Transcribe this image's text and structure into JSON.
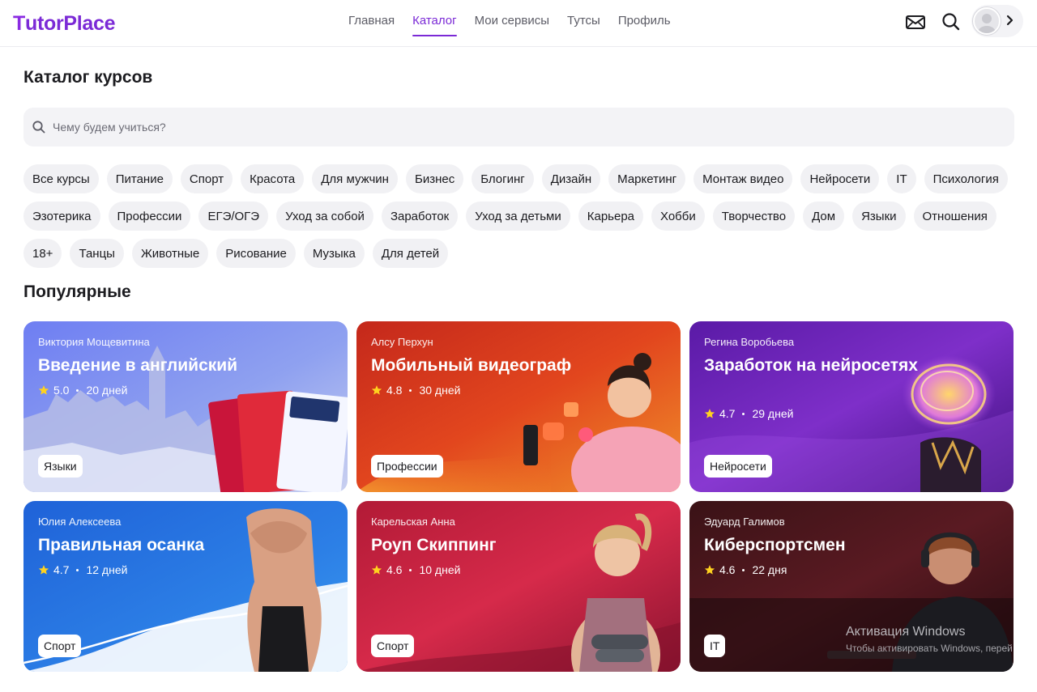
{
  "header": {
    "logo_t": "T",
    "logo_rest": "utorPlace",
    "nav": [
      "Главная",
      "Каталог",
      "Мои сервисы",
      "Тутсы",
      "Профиль"
    ],
    "active_nav": "Каталог"
  },
  "page": {
    "title": "Каталог курсов",
    "search_placeholder": "Чему будем учиться?",
    "popular_title": "Популярные"
  },
  "chips": [
    [
      "Все курсы",
      "Питание",
      "Спорт",
      "Красота",
      "Для мужчин",
      "Бизнес",
      "Блогинг",
      "Дизайн",
      "Маркетинг",
      "Монтаж видео",
      "Нейросети",
      "IT",
      "Психология"
    ],
    [
      "Эзотерика",
      "Профессии",
      "ЕГЭ/ОГЭ",
      "Уход за собой",
      "Заработок",
      "Уход за детьми",
      "Карьера",
      "Хобби",
      "Творчество",
      "Дом",
      "Языки",
      "Отношения"
    ],
    [
      "18+",
      "Танцы",
      "Животные",
      "Рисование",
      "Музыка",
      "Для детей"
    ]
  ],
  "cards": [
    {
      "author": "Виктория Мощевитина",
      "title": "Введение в английский",
      "rating": "5.0",
      "duration": "20 дней",
      "tag": "Языки"
    },
    {
      "author": "Алсу Перхун",
      "title": "Мобильный видеограф",
      "rating": "4.8",
      "duration": "30 дней",
      "tag": "Профессии"
    },
    {
      "author": "Регина Воробьева",
      "title": "Заработок на нейросетях",
      "rating": "4.7",
      "duration": "29 дней",
      "tag": "Нейросети"
    },
    {
      "author": "Юлия Алексеева",
      "title": "Правильная осанка",
      "rating": "4.7",
      "duration": "12 дней",
      "tag": "Спорт"
    },
    {
      "author": "Карельская Анна",
      "title": "Роуп Скиппинг",
      "rating": "4.6",
      "duration": "10 дней",
      "tag": "Спорт"
    },
    {
      "author": "Эдуард Галимов",
      "title": "Киберспортсмен",
      "rating": "4.6",
      "duration": "22 дня",
      "tag": "IT"
    }
  ],
  "watermark": {
    "line1": "Активация Windows",
    "line2": "Чтобы активировать Windows, перей"
  },
  "colors": {
    "accent": "#7b2ad6",
    "chip_bg": "#f1f1f4",
    "star": "#ffd21f"
  },
  "icons": [
    "mail-icon",
    "search-icon",
    "avatar",
    "chevron-right-icon",
    "star-icon"
  ]
}
